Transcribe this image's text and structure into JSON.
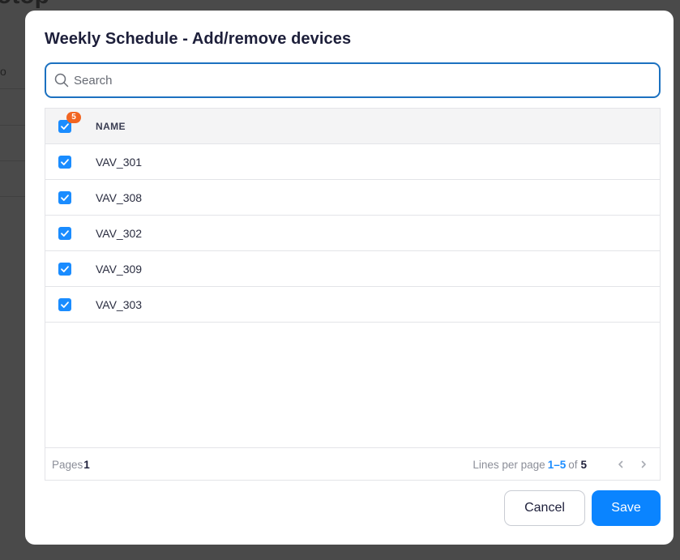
{
  "background": {
    "title_fragment": "otop",
    "column_fragment": "o"
  },
  "modal": {
    "title": "Weekly Schedule - Add/remove devices",
    "search": {
      "placeholder": "Search",
      "value": ""
    },
    "table": {
      "header": {
        "name_label": "NAME",
        "selected_count": "5",
        "select_all_checked": true
      },
      "rows": [
        {
          "name": "VAV_301",
          "checked": true
        },
        {
          "name": "VAV_308",
          "checked": true
        },
        {
          "name": "VAV_302",
          "checked": true
        },
        {
          "name": "VAV_309",
          "checked": true
        },
        {
          "name": "VAV_303",
          "checked": true
        }
      ],
      "footer": {
        "pages_label": "Pages",
        "pages_value": "1",
        "lines_label": "Lines per page",
        "range": "1–5",
        "of_label": "of",
        "total": "5"
      }
    },
    "buttons": {
      "cancel": "Cancel",
      "save": "Save"
    }
  },
  "colors": {
    "accent": "#0a84ff",
    "badge": "#f26522",
    "search_border": "#1c71c0"
  },
  "icons": {
    "search": "search-icon",
    "check": "check-icon",
    "prev": "chevron-left-icon",
    "next": "chevron-right-icon"
  }
}
